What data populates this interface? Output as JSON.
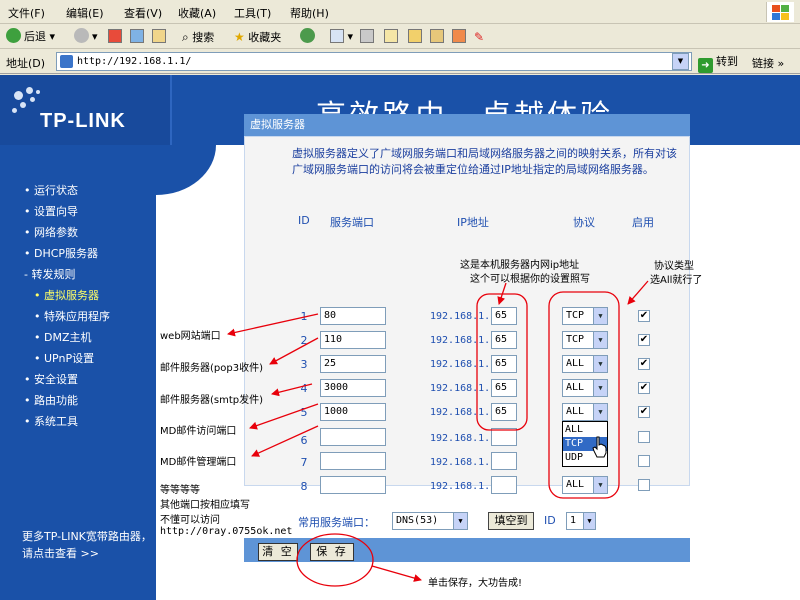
{
  "browser": {
    "menu": [
      "文件(F)",
      "编辑(E)",
      "查看(V)",
      "收藏(A)",
      "工具(T)",
      "帮助(H)"
    ],
    "toolbar": {
      "back": "后退",
      "search": "搜索",
      "favorites": "收藏夹"
    },
    "address_label": "地址(D)",
    "url": "http://192.168.1.1/",
    "go_label": "转到",
    "links_label": "链接"
  },
  "router": {
    "logo": "TP-LINK",
    "slogan": "高效路由，卓越体验"
  },
  "sidebar": {
    "items": [
      {
        "label": "• 运行状态"
      },
      {
        "label": "• 设置向导"
      },
      {
        "label": "• 网络参数"
      },
      {
        "label": "• DHCP服务器"
      },
      {
        "label": "- 转发规则"
      },
      {
        "label": "• 虚拟服务器"
      },
      {
        "label": "• 特殊应用程序"
      },
      {
        "label": "• DMZ主机"
      },
      {
        "label": "• UPnP设置"
      },
      {
        "label": "• 安全设置"
      },
      {
        "label": "• 路由功能"
      },
      {
        "label": "• 系统工具"
      }
    ],
    "more": "更多TP-LINK宽带路由器，请点击查看 >>"
  },
  "panel": {
    "title": "虚拟服务器",
    "description": "虚拟服务器定义了广域网服务端口和局域网络服务器之间的映射关系，所有对该广域网服务端口的访问将会被重定位给通过IP地址指定的局域网络服务器。",
    "headers": {
      "id": "ID",
      "port": "服务端口",
      "ip": "IP地址",
      "protocol": "协议",
      "enable": "启用"
    },
    "ip_prefix": "192.168.1.",
    "rows": [
      {
        "id": "1",
        "port": "80",
        "ip": "65",
        "protocol": "TCP",
        "enabled": true
      },
      {
        "id": "2",
        "port": "110",
        "ip": "65",
        "protocol": "TCP",
        "enabled": true
      },
      {
        "id": "3",
        "port": "25",
        "ip": "65",
        "protocol": "ALL",
        "enabled": true
      },
      {
        "id": "4",
        "port": "3000",
        "ip": "65",
        "protocol": "ALL",
        "enabled": true
      },
      {
        "id": "5",
        "port": "1000",
        "ip": "65",
        "protocol": "ALL",
        "enabled": true
      },
      {
        "id": "6",
        "port": "",
        "ip": "",
        "protocol": "",
        "enabled": false
      },
      {
        "id": "7",
        "port": "",
        "ip": "",
        "protocol": "",
        "enabled": false
      },
      {
        "id": "8",
        "port": "",
        "ip": "",
        "protocol": "ALL",
        "enabled": false
      }
    ],
    "dropdown_options": [
      "ALL",
      "TCP",
      "UDP"
    ],
    "dropdown_selected": "TCP",
    "common_port_label": "常用服务端口：",
    "common_port_value": "DNS(53)",
    "fill_button": "填空到",
    "id_label": "ID",
    "id_value": "1",
    "clear_button": "清 空",
    "save_button": "保 存"
  },
  "annotations": {
    "ip_note_1": "这是本机服务器内网ip地址",
    "ip_note_2": "这个可以根据你的设置照写",
    "proto_note_1": "协议类型",
    "proto_note_2": "选All就行了",
    "web": "web网站端口",
    "pop3": "邮件服务器(pop3收件)",
    "smtp": "邮件服务器(smtp发件)",
    "md_access": "MD邮件访问端口",
    "md_admin": "MD邮件管理端口",
    "etc_1": "等等等等",
    "etc_2": "其他端口按相应填写",
    "etc_3": "不懂可以访问",
    "etc_4": "http://0ray.0755ok.net",
    "save_note": "单击保存，大功告成!"
  },
  "colors": {
    "annotation_red": "#e8000b",
    "brand_blue": "#1a51a8",
    "text_blue": "#1f4fb0"
  }
}
